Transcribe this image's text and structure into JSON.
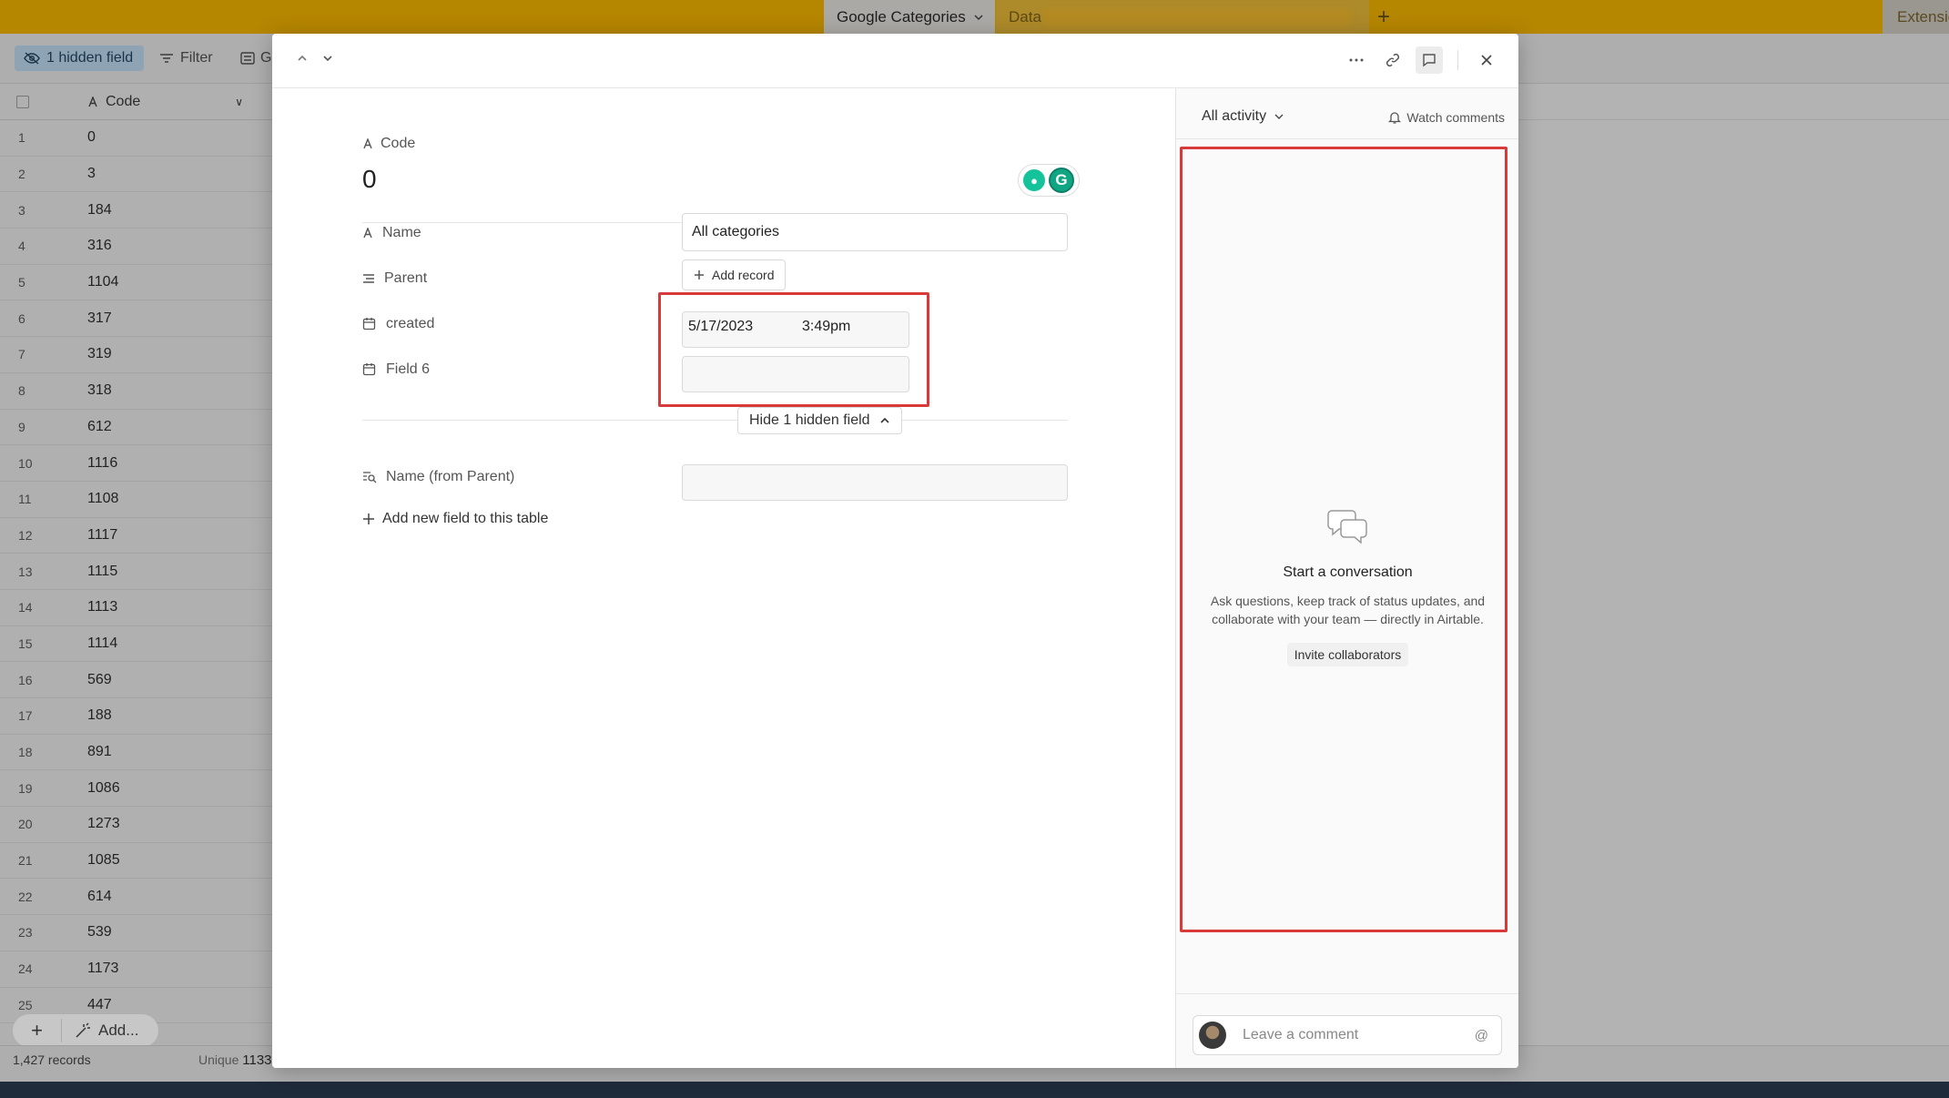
{
  "tabs": {
    "active": "Google Categories",
    "second": "Data",
    "add": "+",
    "extensions": "Extensions"
  },
  "toolbar": {
    "hidden_fields": "1 hidden field",
    "filter": "Filter",
    "group": "G"
  },
  "grid": {
    "column": "Code",
    "rows": [
      {
        "n": "1",
        "code": "0"
      },
      {
        "n": "2",
        "code": "3"
      },
      {
        "n": "3",
        "code": "184"
      },
      {
        "n": "4",
        "code": "316"
      },
      {
        "n": "5",
        "code": "1104"
      },
      {
        "n": "6",
        "code": "317"
      },
      {
        "n": "7",
        "code": "319"
      },
      {
        "n": "8",
        "code": "318"
      },
      {
        "n": "9",
        "code": "612"
      },
      {
        "n": "10",
        "code": "1116"
      },
      {
        "n": "11",
        "code": "1108"
      },
      {
        "n": "12",
        "code": "1117"
      },
      {
        "n": "13",
        "code": "1115"
      },
      {
        "n": "14",
        "code": "1113"
      },
      {
        "n": "15",
        "code": "1114"
      },
      {
        "n": "16",
        "code": "569"
      },
      {
        "n": "17",
        "code": "188"
      },
      {
        "n": "18",
        "code": "891"
      },
      {
        "n": "19",
        "code": "1086"
      },
      {
        "n": "20",
        "code": "1273"
      },
      {
        "n": "21",
        "code": "1085"
      },
      {
        "n": "22",
        "code": "614"
      },
      {
        "n": "23",
        "code": "539"
      },
      {
        "n": "24",
        "code": "1173"
      },
      {
        "n": "25",
        "code": "447"
      }
    ],
    "add_label": "Add...",
    "records": "1,427 records",
    "unique_label": "Unique",
    "unique_value": "1133"
  },
  "record": {
    "primary_field": "Code",
    "primary_value": "0",
    "fields": {
      "name_label": "Name",
      "name_value": "All categories",
      "parent_label": "Parent",
      "add_record": "Add record",
      "created_label": "created",
      "created_date": "5/17/2023",
      "created_time": "3:49pm",
      "field6_label": "Field 6",
      "field6_value": "",
      "hide_hidden": "Hide 1 hidden field",
      "lookup_label": "Name (from Parent)",
      "lookup_value": ""
    },
    "add_field": "Add new field to this table"
  },
  "activity": {
    "filter": "All activity",
    "watch": "Watch comments",
    "empty_title": "Start a conversation",
    "empty_desc": "Ask questions, keep track of status updates, and collaborate with your team — directly in Airtable.",
    "invite": "Invite collaborators",
    "comment_placeholder": "Leave a comment",
    "mention": "@"
  },
  "colors": {
    "topbar": "#b58600",
    "highlight": "#d83a3a",
    "grammarly": "#15c39a"
  }
}
